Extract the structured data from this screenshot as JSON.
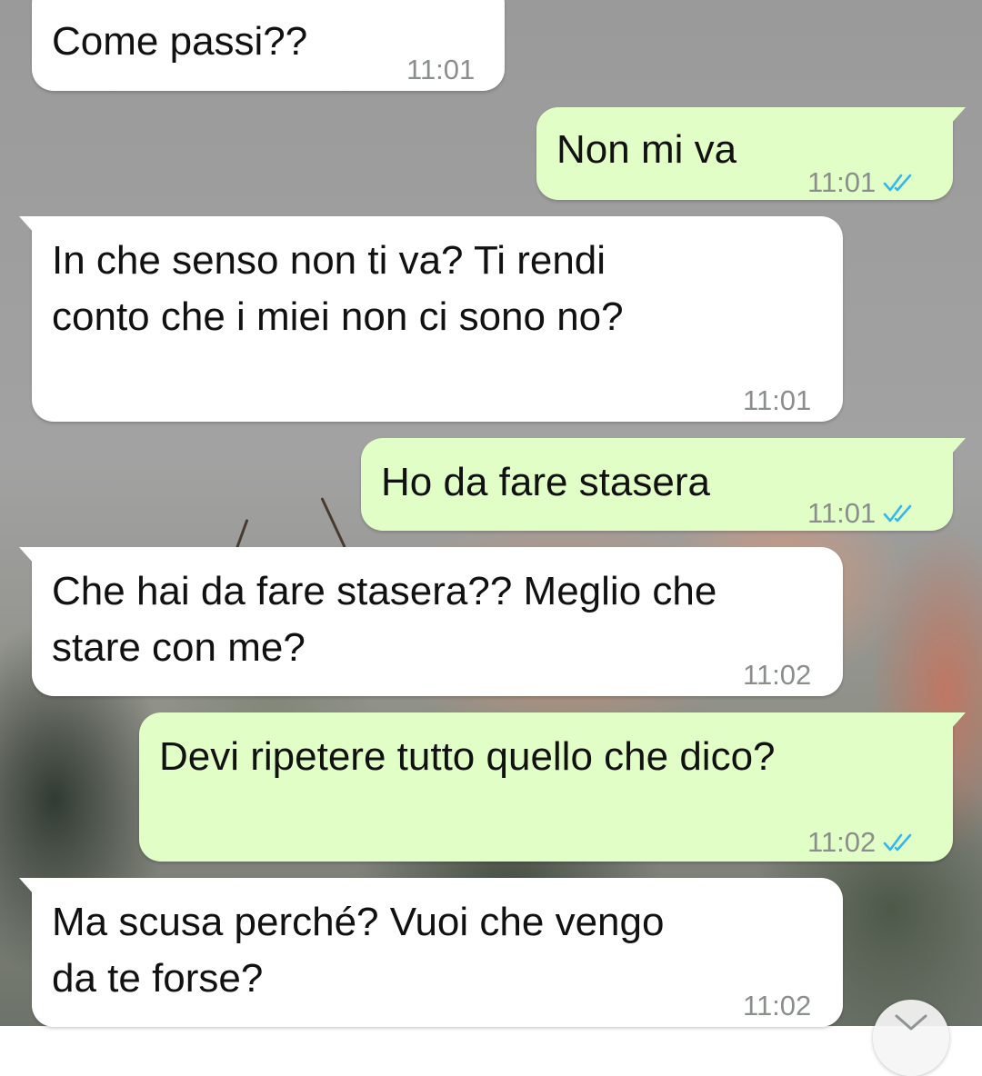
{
  "messages": [
    {
      "direction": "incoming",
      "text_lines": [
        "Come passi??"
      ],
      "time": "11:01"
    },
    {
      "direction": "outgoing",
      "text_lines": [
        "Non mi va"
      ],
      "time": "11:01",
      "read": true
    },
    {
      "direction": "incoming",
      "text_lines": [
        "In che senso non ti va? Ti rendi",
        "conto che i miei non ci sono no?"
      ],
      "time": "11:01"
    },
    {
      "direction": "outgoing",
      "text_lines": [
        "Ho da fare stasera"
      ],
      "time": "11:01",
      "read": true
    },
    {
      "direction": "incoming",
      "text_lines": [
        "Che hai da fare stasera?? Meglio che",
        "stare con me?"
      ],
      "time": "11:02"
    },
    {
      "direction": "outgoing",
      "text_lines": [
        "Devi ripetere tutto quello che dico?"
      ],
      "time": "11:02",
      "read": true
    },
    {
      "direction": "incoming",
      "text_lines": [
        "Ma scusa perché? Vuoi che vengo",
        "da te forse?"
      ],
      "time": "11:02"
    }
  ],
  "icons": {
    "read_receipt": "double-check-icon",
    "scroll_down": "chevron-down-icon"
  },
  "colors": {
    "incoming_bubble": "#ffffff",
    "outgoing_bubble": "#e1fec6",
    "timestamp": "#8b8f8b",
    "read_ticks": "#34b7f1"
  }
}
